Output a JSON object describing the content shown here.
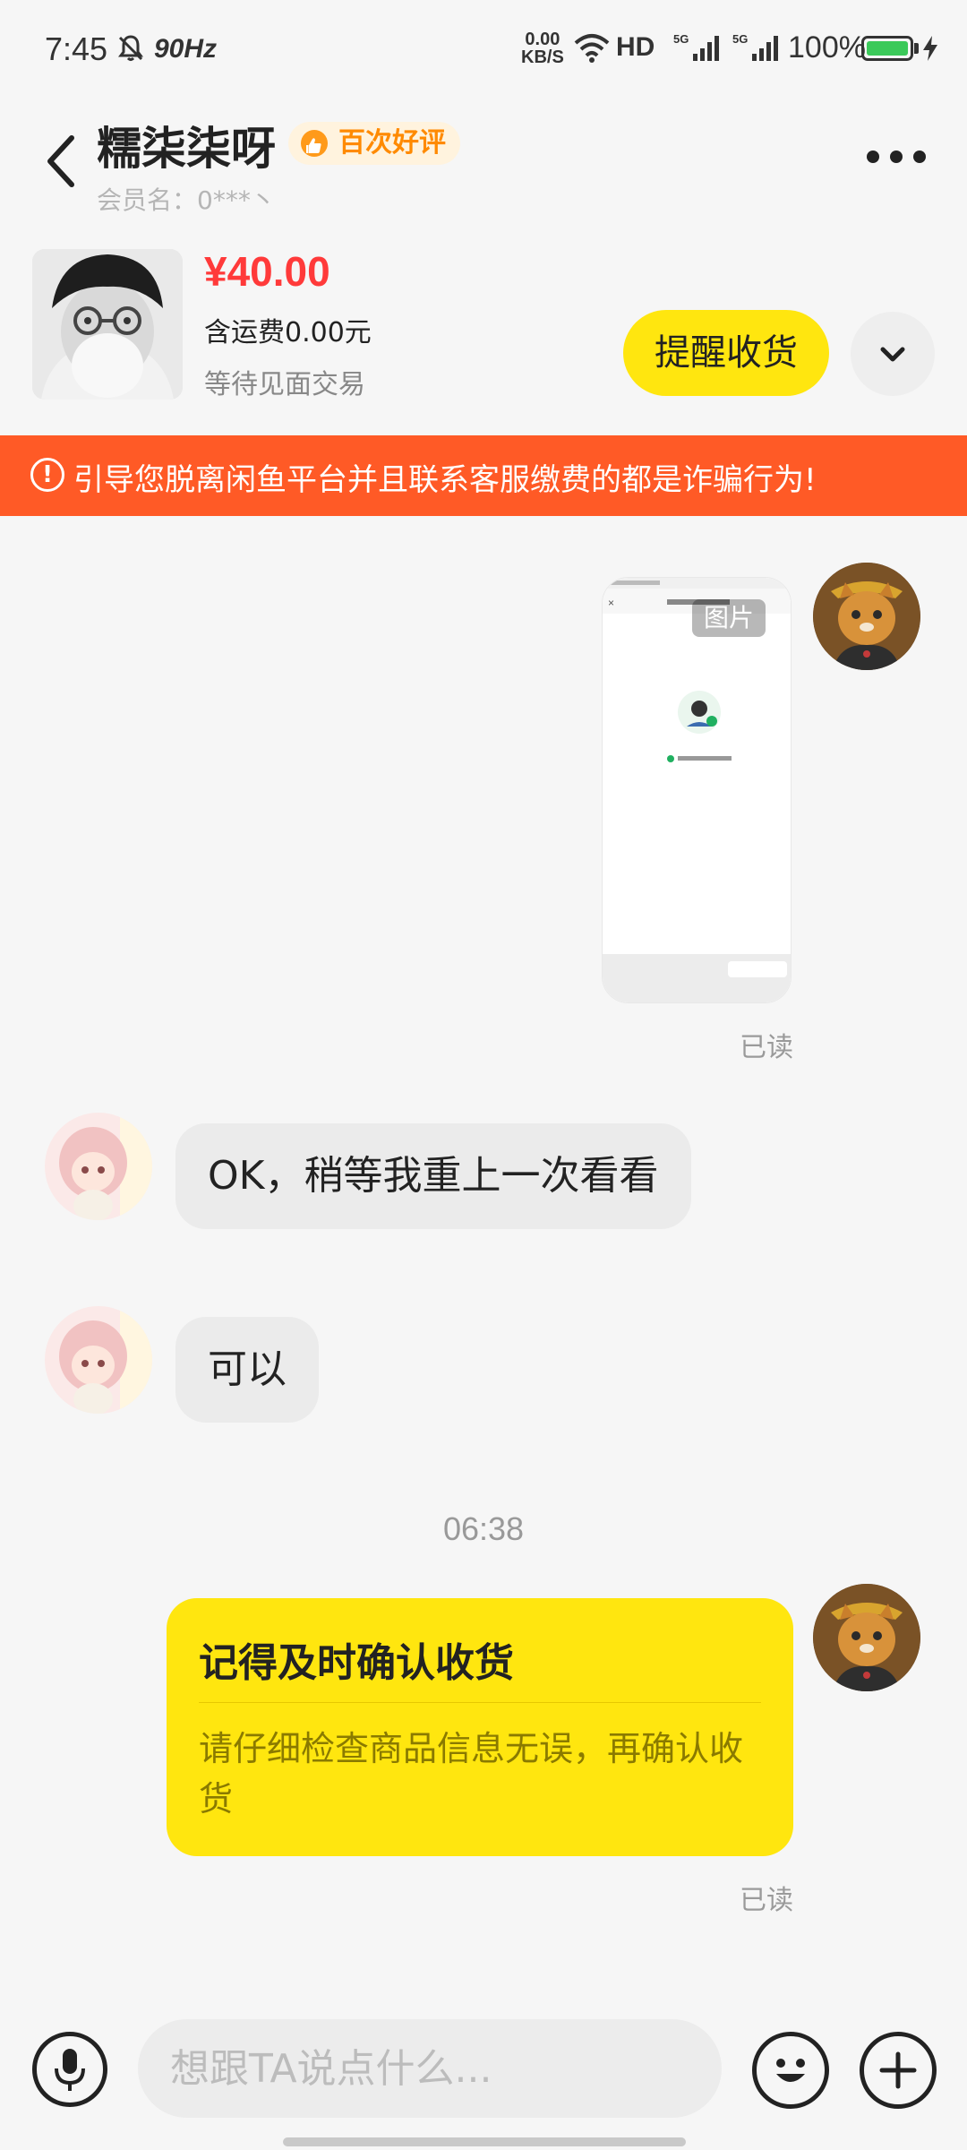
{
  "status_bar": {
    "time": "7:45",
    "refresh_rate": "90Hz",
    "net_speed_value": "0.00",
    "net_speed_unit": "KB/S",
    "hd_label": "HD",
    "battery_percent": "100%"
  },
  "header": {
    "seller_name": "糯柒柒呀",
    "rating_badge": "百次好评",
    "member_label": "会员名：0***丶"
  },
  "product": {
    "price": "¥40.00",
    "shipping": "含运费0.00元",
    "status": "等待见面交易",
    "remind_button": "提醒收货"
  },
  "warning_banner": {
    "text": "引导您脱离闲鱼平台并且联系客服缴费的都是诈骗行为!"
  },
  "messages": {
    "image_badge": "图片",
    "image_read": "已读",
    "msg1": "OK，稍等我重上一次看看",
    "msg2": "可以",
    "timestamp": "06:38",
    "card_title": "记得及时确认收货",
    "card_body": "请仔细检查商品信息无误，再确认收货",
    "card_read": "已读"
  },
  "input_bar": {
    "placeholder": "想跟TA说点什么..."
  },
  "colors": {
    "accent_yellow": "#ffe60f",
    "warning_orange": "#ff5a26",
    "price_red": "#ff3a3a"
  }
}
